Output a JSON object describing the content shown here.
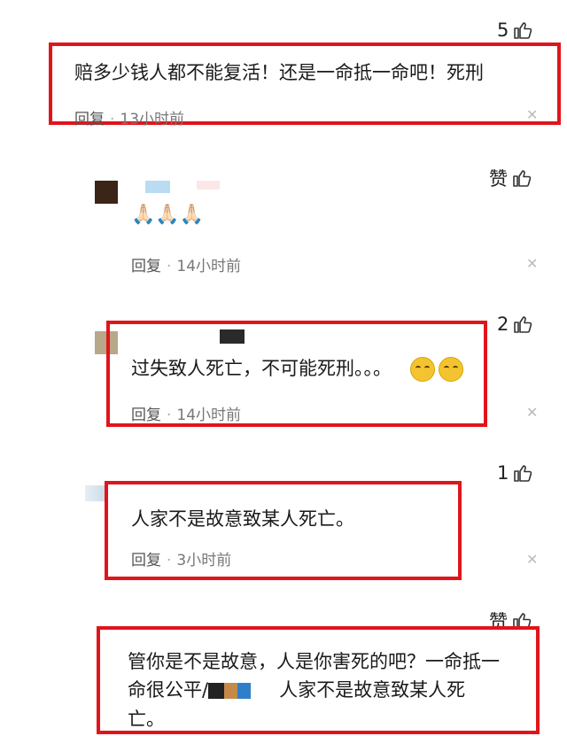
{
  "comments": [
    {
      "likes": "5",
      "text": "赔多少钱人都不能复活！还是一命抵一命吧！死刑",
      "reply_label": "回复",
      "time": "13小时前"
    },
    {
      "likes": "赞",
      "emoji": "🙏🏻🙏🏻🙏🏻",
      "reply_label": "回复",
      "time": "14小时前"
    },
    {
      "likes": "2",
      "text": "过失致人死亡，不可能死刑。。。",
      "reply_label": "回复",
      "time": "14小时前"
    },
    {
      "likes": "1",
      "text": "人家不是故意致某人死亡。",
      "reply_label": "回复",
      "time": "3小时前"
    },
    {
      "likes": "赞",
      "text_line1": "管你是不是故意，人是你害死的吧？一命抵一",
      "text_line2_a": "命很公平/",
      "text_line2_b": "人家不是故意致某人死",
      "text_line3": "亡。"
    }
  ],
  "icons": {
    "like": "thumbs-up-icon",
    "close": "close-icon"
  },
  "colors": {
    "highlight": "#e0151b"
  }
}
